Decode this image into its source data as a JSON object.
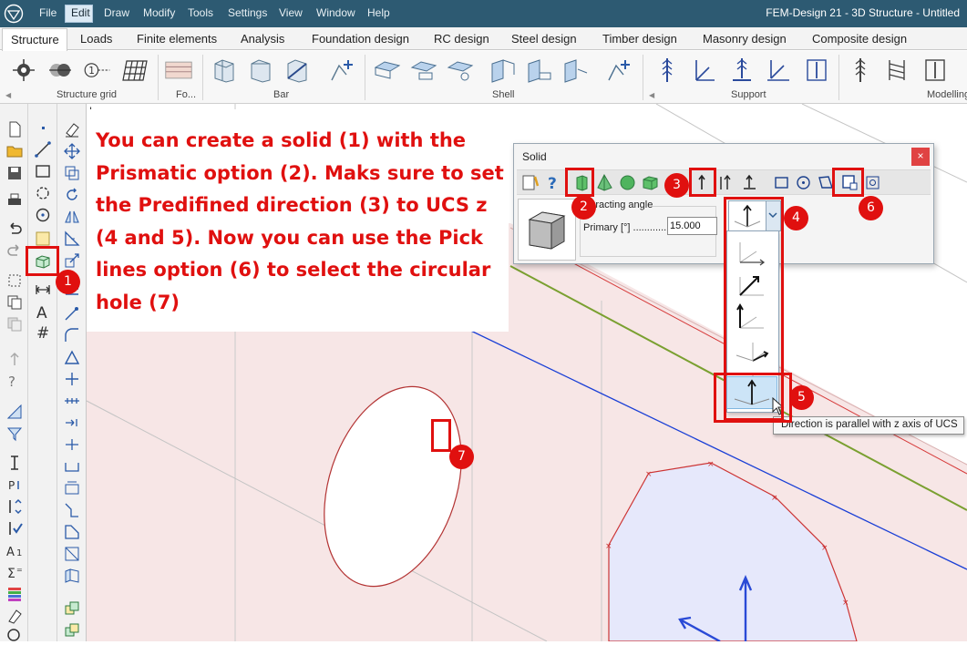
{
  "window": {
    "title": "FEM-Design 21 - 3D Structure - Untitled",
    "menu": [
      "File",
      "Edit",
      "Draw",
      "Modify",
      "Tools",
      "Settings",
      "View",
      "Window",
      "Help"
    ]
  },
  "ribbon": {
    "tabs": [
      "Structure",
      "Loads",
      "Finite elements",
      "Analysis",
      "Foundation design",
      "RC design",
      "Steel design",
      "Timber design",
      "Masonry design",
      "Composite design"
    ],
    "active_tab": "Structure",
    "groups": [
      "Structure grid",
      "Fo...",
      "Bar",
      "Shell",
      "Support",
      "Modelling"
    ]
  },
  "callout": {
    "text": "You can create a solid (1) with the Prismatic option (2). Maks sure to set the Predifined direction (3) to UCS z (4 and 5). Now you can use the Pick lines option (6) to select the circular hole (7)"
  },
  "solid_dialog": {
    "title": "Solid",
    "close_label": "×",
    "angle_group_label": "Bracting angle",
    "primary_label": "Primary [°] ............",
    "primary_value": "15.000"
  },
  "tooltip": "Direction is parallel with z axis of UCS",
  "markers": [
    "1",
    "2",
    "3",
    "4",
    "5",
    "6",
    "7"
  ],
  "canvas_tool_label": "I",
  "colors": {
    "accent_red": "#e0100f",
    "title_bar": "#2d5a72",
    "wall_fill": "#f7e6e6",
    "poly_fill": "#e6e8fb",
    "outline_red": "#cc3333",
    "axis_blue": "#1a3fd6"
  }
}
